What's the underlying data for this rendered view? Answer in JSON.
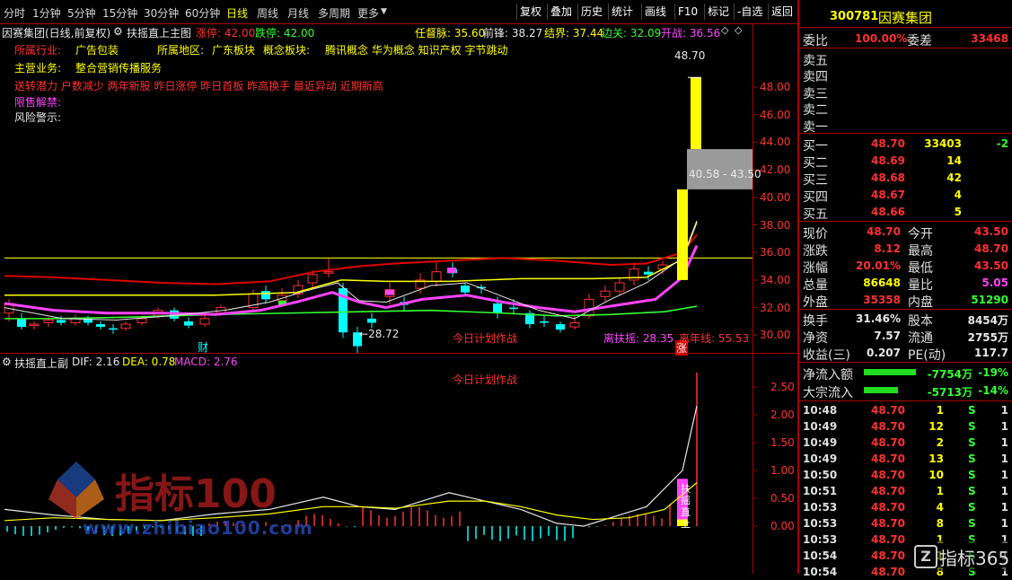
{
  "toolbar": {
    "periods": [
      "分时",
      "1分钟",
      "5分钟",
      "15分钟",
      "30分钟",
      "60分钟",
      "日线",
      "周线",
      "月线",
      "多周期",
      "更多"
    ],
    "active_period": "日线",
    "right_tools": [
      "复权",
      "叠加",
      "历史",
      "统计",
      "画线",
      "F10",
      "标记",
      "-自选",
      "返回"
    ]
  },
  "chart_header": {
    "title": "因赛集团(日线,前复权)",
    "formula": "扶摇直上主图",
    "limit_up_label": "涨停: 42.00",
    "limit_down_label": "跌停: 42.00",
    "indicators": [
      {
        "text": "任督脉: 35.60",
        "color": "#ffff00"
      },
      {
        "text": "前锋: 38.27",
        "color": "#e8e8e8"
      },
      {
        "text": "结界: 37.44",
        "color": "#ffff00"
      },
      {
        "text": "边关: 32.09",
        "color": "#33ff33"
      },
      {
        "text": "开战: 36.56",
        "color": "#ff44ff"
      }
    ]
  },
  "info": {
    "industry_label": "所属行业:",
    "industry": "广告包装",
    "region_label": "所属地区:",
    "region": "广东板块",
    "concept_label": "概念板块:",
    "concepts": "腾讯概念 华为概念 知识产权 字节跳动",
    "business_label": "主营业务:",
    "business": "整合营销传播服务",
    "tags": "送转潜力 户数减少 两年新股 昨日涨停 昨日首板 昨高换手 最近异动 近期新高",
    "unlock_label": "限售解禁:",
    "risk_label": "风险警示:"
  },
  "main_axis": {
    "ticks": [
      "48.00",
      "46.00",
      "44.00",
      "42.00",
      "40.00",
      "38.00",
      "36.00",
      "34.00",
      "32.00",
      "30.00"
    ],
    "price_high_label": "48.70",
    "price_box_label": "40.58 - 43.50",
    "low_marker": "28.72",
    "plan_text": "今日计划作战",
    "bottom_left_label": "财",
    "bottom_right_label": "涨",
    "distance_label": "离扶摇: 28.35",
    "year_line_label": "离年线: 55.53"
  },
  "sub_chart": {
    "title": "扶摇直上副",
    "dif": "DIF: 2.16",
    "dea": "DEA: 0.78",
    "macd": "MACD: 2.76",
    "plan_text": "今日计划作战",
    "signal_text": "扶摇直上",
    "ticks": [
      "2.50",
      "2.00",
      "1.50",
      "1.00",
      "0.50",
      "0.00"
    ],
    "watermark_cn": "指标100",
    "watermark_en": "www.zhibiao100.com"
  },
  "colors": {
    "up": "#ff3030",
    "down": "#00ffff",
    "ma_red": "#e00000",
    "ma_yellow": "#ffff00",
    "ma_green": "#33ff33",
    "ma_magenta": "#ff44ff",
    "ma_white": "#e8e8e8",
    "panel_border": "#aa0000"
  },
  "quote": {
    "code": "300781",
    "name": "因赛集团",
    "weibi_label": "委比",
    "weibi": "100.00%",
    "weicha_label": "委差",
    "weicha": "33468",
    "asks": [
      {
        "label": "卖五",
        "price": "",
        "vol": ""
      },
      {
        "label": "卖四",
        "price": "",
        "vol": ""
      },
      {
        "label": "卖三",
        "price": "",
        "vol": ""
      },
      {
        "label": "卖二",
        "price": "",
        "vol": ""
      },
      {
        "label": "卖一",
        "price": "",
        "vol": ""
      }
    ],
    "bids": [
      {
        "label": "买一",
        "price": "48.70",
        "vol": "33403",
        "chg": "-2"
      },
      {
        "label": "买二",
        "price": "48.69",
        "vol": "14",
        "chg": ""
      },
      {
        "label": "买三",
        "price": "48.68",
        "vol": "42",
        "chg": ""
      },
      {
        "label": "买四",
        "price": "48.67",
        "vol": "4",
        "chg": ""
      },
      {
        "label": "买五",
        "price": "48.66",
        "vol": "5",
        "chg": ""
      }
    ],
    "stats": [
      {
        "l1": "现价",
        "v1": "48.70",
        "c1": "#ff3030",
        "l2": "今开",
        "v2": "43.50",
        "c2": "#ff3030"
      },
      {
        "l1": "涨跌",
        "v1": "8.12",
        "c1": "#ff3030",
        "l2": "最高",
        "v2": "48.70",
        "c2": "#ff3030"
      },
      {
        "l1": "涨幅",
        "v1": "20.01%",
        "c1": "#ff3030",
        "l2": "最低",
        "v2": "43.50",
        "c2": "#ff3030"
      },
      {
        "l1": "总量",
        "v1": "86648",
        "c1": "#ffff00",
        "l2": "量比",
        "v2": "5.05",
        "c2": "#ff44ff"
      },
      {
        "l1": "外盘",
        "v1": "35358",
        "c1": "#ff3030",
        "l2": "内盘",
        "v2": "51290",
        "c2": "#33ff33"
      }
    ],
    "stats2": [
      {
        "l1": "换手",
        "v1": "31.46%",
        "c1": "#e8e8e8",
        "l2": "股本",
        "v2": "8454万",
        "c2": "#e8e8e8"
      },
      {
        "l1": "净资",
        "v1": "7.57",
        "c1": "#e8e8e8",
        "l2": "流通",
        "v2": "2755万",
        "c2": "#e8e8e8"
      },
      {
        "l1": "收益(三)",
        "v1": "0.207",
        "c1": "#e8e8e8",
        "l2": "PE(动)",
        "v2": "117.7",
        "c2": "#e8e8e8"
      }
    ],
    "flows": [
      {
        "label": "净流入额",
        "value": "-7754万",
        "pct": "-19%"
      },
      {
        "label": "大宗流入",
        "value": "-5713万",
        "pct": "-14%"
      }
    ],
    "ticks": [
      {
        "time": "10:48",
        "price": "48.70",
        "vol": "1",
        "side": "S",
        "n": "1"
      },
      {
        "time": "10:49",
        "price": "48.70",
        "vol": "12",
        "side": "S",
        "n": "1"
      },
      {
        "time": "10:49",
        "price": "48.70",
        "vol": "2",
        "side": "S",
        "n": "1"
      },
      {
        "time": "10:49",
        "price": "48.70",
        "vol": "13",
        "side": "S",
        "n": "1"
      },
      {
        "time": "10:50",
        "price": "48.70",
        "vol": "10",
        "side": "S",
        "n": "1"
      },
      {
        "time": "10:51",
        "price": "48.70",
        "vol": "1",
        "side": "S",
        "n": "1"
      },
      {
        "time": "10:53",
        "price": "48.70",
        "vol": "4",
        "side": "S",
        "n": "1"
      },
      {
        "time": "10:53",
        "price": "48.70",
        "vol": "8",
        "side": "S",
        "n": "1"
      },
      {
        "time": "10:53",
        "price": "48.70",
        "vol": "1",
        "side": "S",
        "n": "1"
      },
      {
        "time": "10:54",
        "price": "48.70",
        "vol": "1",
        "side": "S",
        "n": "1"
      },
      {
        "time": "10:54",
        "price": "48.70",
        "vol": "8",
        "side": "S",
        "n": "1"
      }
    ],
    "logo": "指标365"
  }
}
